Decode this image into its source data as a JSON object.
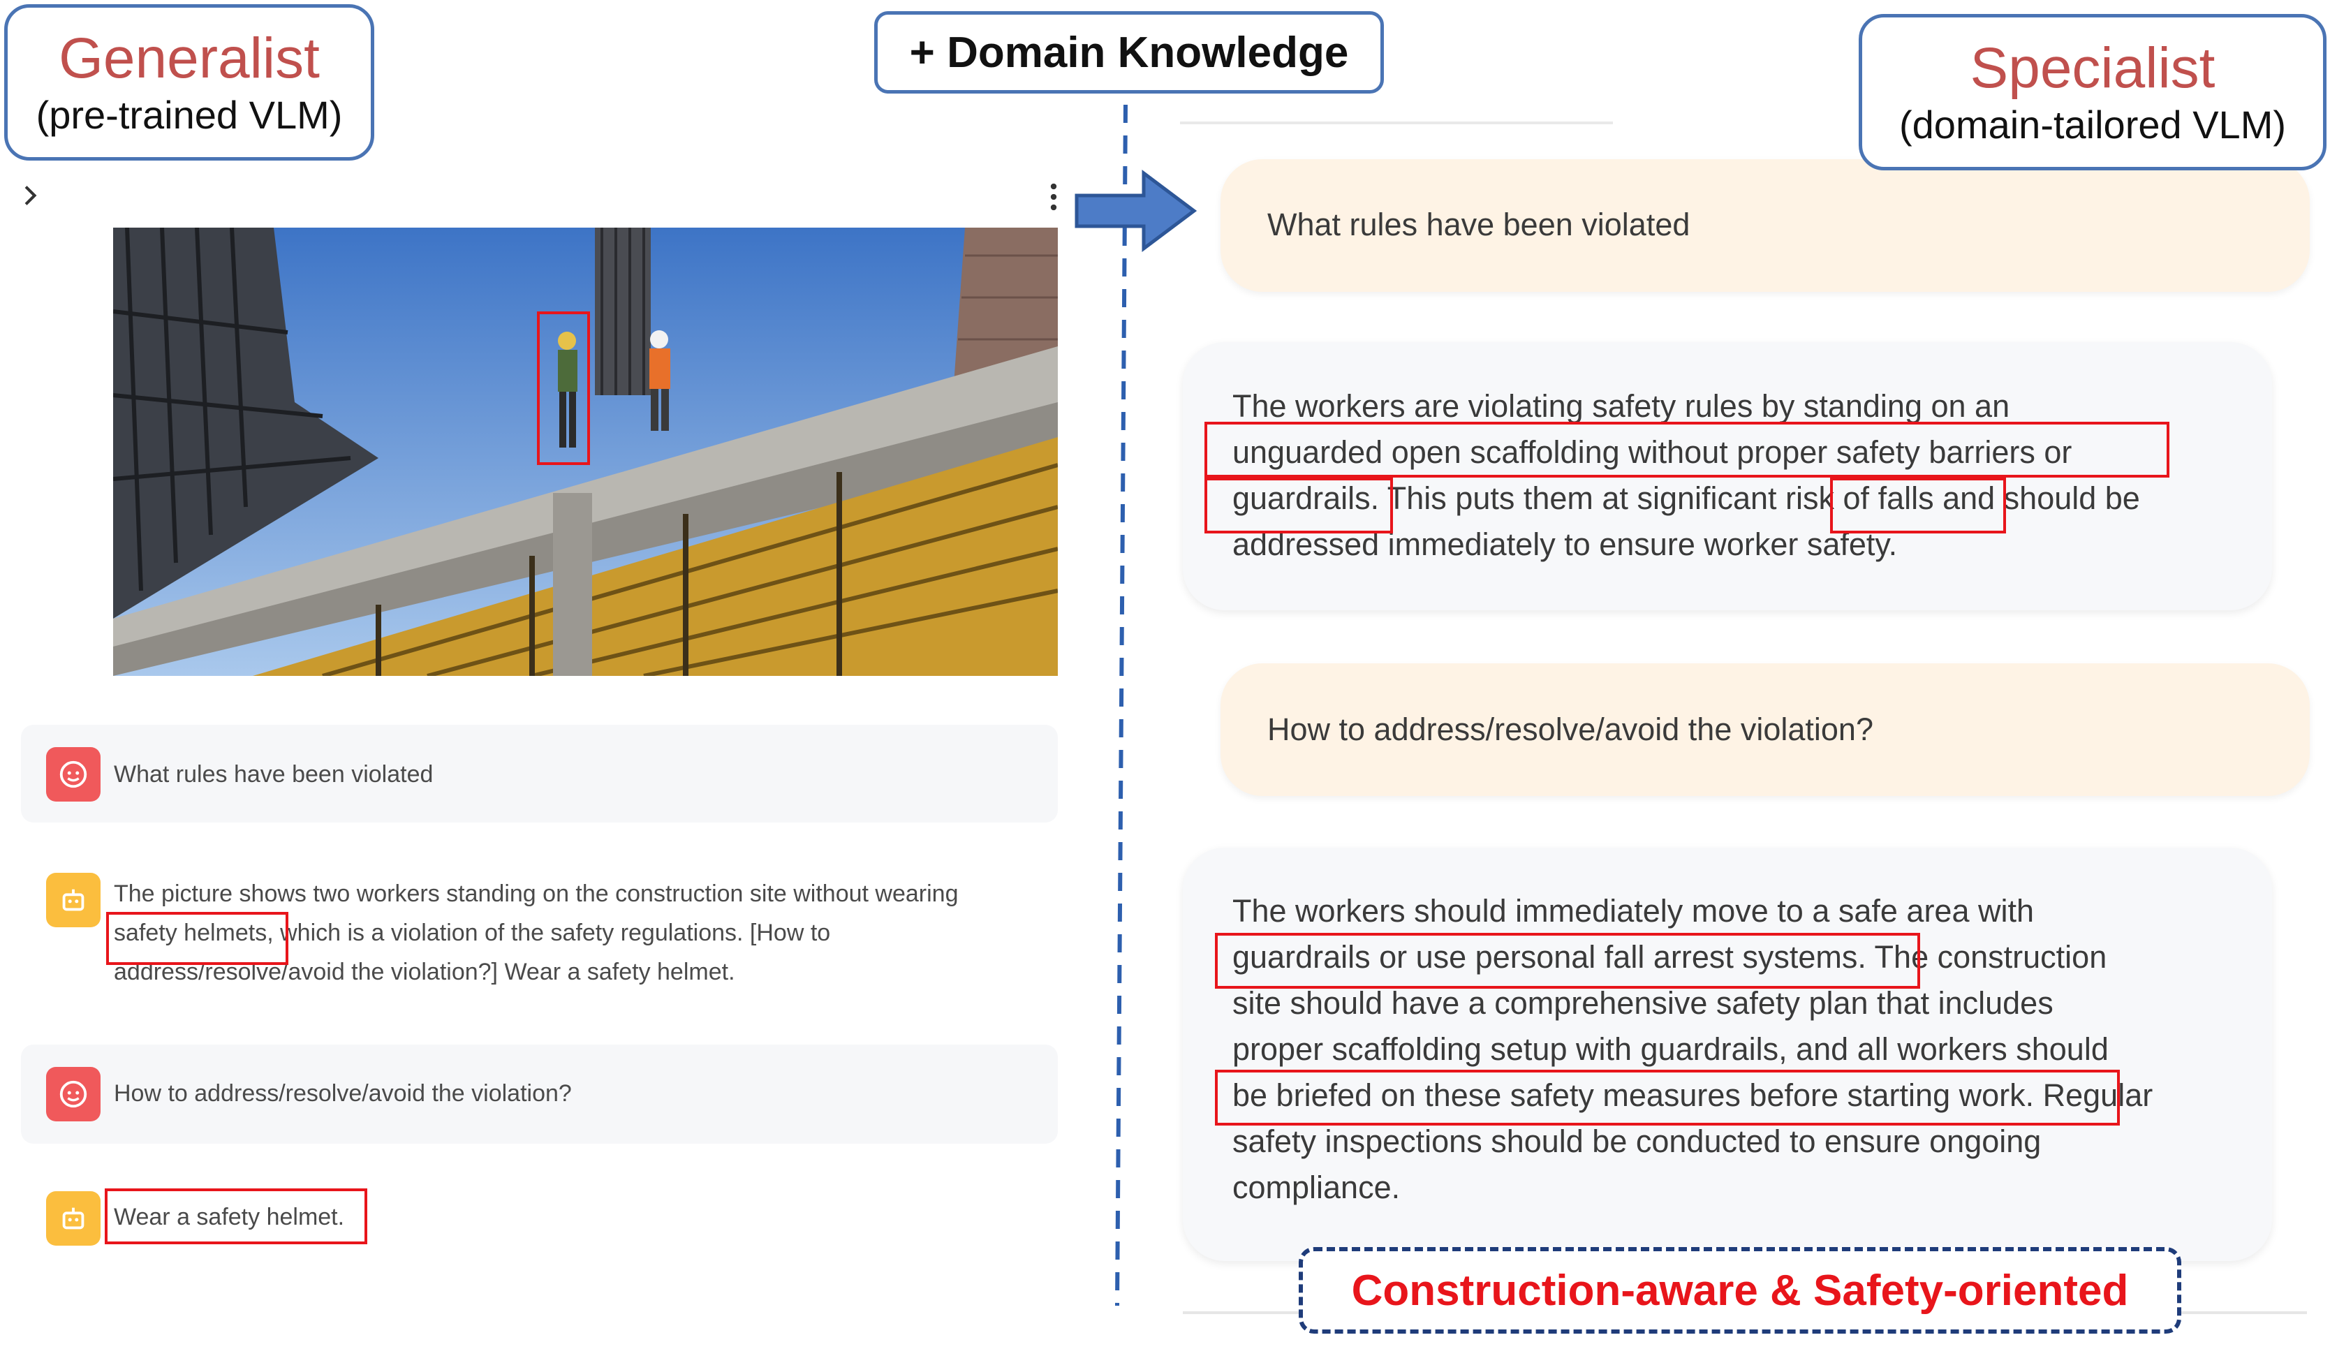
{
  "generalist": {
    "title": "Generalist",
    "subtitle": "(pre-trained VLM)"
  },
  "specialist": {
    "title": "Specialist",
    "subtitle": "(domain-tailored VLM)"
  },
  "domain_knowledge": "+ Domain Knowledge",
  "left_chat": {
    "q1": "What rules have been violated",
    "a1_lines": [
      "The picture shows two workers standing on the construction site without wearing",
      "safety helmets, which is a violation of the safety regulations. [How to",
      "address/resolve/avoid the violation?] Wear a safety helmet."
    ],
    "q2": "How to address/resolve/avoid the violation?",
    "a2": "Wear a safety helmet."
  },
  "right_chat": {
    "q1": "What rules have been violated",
    "a1_lines": [
      "The workers are violating safety rules by standing on an",
      "unguarded open scaffolding without proper safety barriers or",
      "guardrails. This puts them at significant risk of falls and should be",
      "addressed immediately to ensure worker safety."
    ],
    "q2": "How to address/resolve/avoid the violation?",
    "a2_lines": [
      "The workers should immediately move to a safe area with",
      "guardrails or use personal fall arrest systems. The construction",
      "site should have a comprehensive safety plan that includes",
      "proper scaffolding setup with guardrails, and all workers should",
      "be briefed on these safety measures before starting work. Regular",
      "safety inspections should be conducted to ensure ongoing",
      "compliance."
    ]
  },
  "tag": "Construction-aware & Safety-oriented",
  "colors": {
    "highlight_red": "#e8151b",
    "box_blue": "#4a74b4",
    "title_red": "#c0504d",
    "user_avatar": "#f0595b",
    "bot_avatar": "#fbbe3e"
  },
  "icons": [
    "chevron-right-icon",
    "kebab-menu-icon",
    "arrow-right-icon",
    "user-avatar-icon",
    "bot-avatar-icon"
  ]
}
